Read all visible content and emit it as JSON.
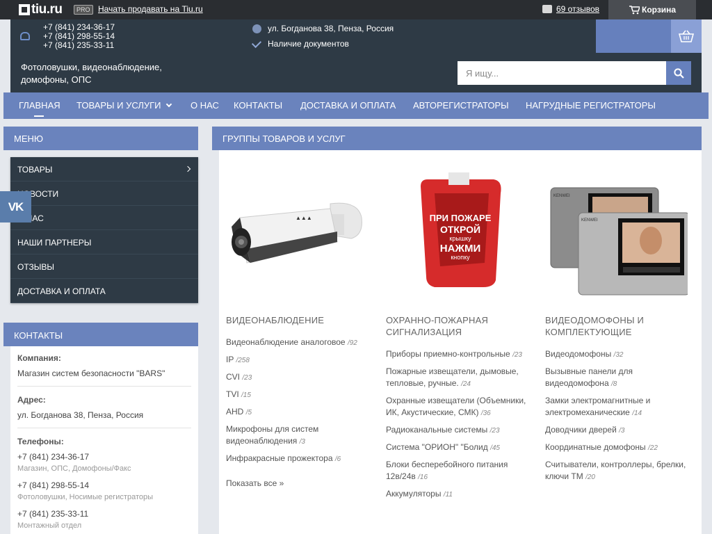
{
  "topbar": {
    "logo_text": "tiu.ru",
    "pro_badge": "PRO",
    "sell_link": "Начать продавать на Tiu.ru",
    "reviews_link": "69 отзывов",
    "cart_label": "Корзина"
  },
  "header": {
    "phones": [
      "+7 (841) 234-36-17",
      "+7 (841) 298-55-14",
      "+7 (841) 235-33-11"
    ],
    "address": "ул. Богданова 38, Пенза, Россия",
    "documents": "Наличие документов",
    "tagline": "Фотоловушки, видеонаблюдение, домофоны, ОПС",
    "search_placeholder": "Я ищу..."
  },
  "nav": {
    "items": [
      "Главная",
      "Товары и услуги",
      "О нас",
      "Контакты",
      "Доставка и оплата",
      "Авторегистраторы",
      "Нагрудные регистраторы"
    ]
  },
  "side_menu": {
    "title": "МЕНЮ",
    "items": [
      "Товары",
      "Новости",
      "О нас",
      "Наши партнеры",
      "Отзывы",
      "Доставка и оплата"
    ]
  },
  "vk_label": "VK",
  "contacts": {
    "title": "КОНТАКТЫ",
    "company_label": "Компания:",
    "company": "Магазин систем безопасности \"BARS\"",
    "address_label": "Адрес:",
    "address": "ул. Богданова 38, Пенза, Россия",
    "phones_label": "Телефоны:",
    "phones": [
      {
        "number": "+7 (841) 234-36-17",
        "note": "Магазин, ОПС, Домофоны/Факс"
      },
      {
        "number": "+7 (841) 298-55-14",
        "note": "Фотоловушки, Носимые регистраторы"
      },
      {
        "number": "+7 (841) 235-33-11",
        "note": "Монтажный отдел"
      }
    ]
  },
  "main": {
    "title": "ГРУППЫ ТОВАРОВ И УСЛУГ",
    "columns": [
      {
        "title": "Видеонаблюдение",
        "items": [
          {
            "name": "Видеонаблюдение аналоговое",
            "count": "/92"
          },
          {
            "name": "IP",
            "count": "/258"
          },
          {
            "name": "CVI",
            "count": "/23"
          },
          {
            "name": "TVI",
            "count": "/15"
          },
          {
            "name": "AHD",
            "count": "/5"
          },
          {
            "name": "Микрофоны для систем видеонаблюдения",
            "count": "/3"
          },
          {
            "name": "Инфракрасные прожектора",
            "count": "/6"
          }
        ],
        "show_all": "Показать все"
      },
      {
        "title": "Охранно-пожарная сигнализация",
        "items": [
          {
            "name": "Приборы приемно-контрольные",
            "count": "/23"
          },
          {
            "name": "Пожарные извещатели, дымовые, тепловые, ручные.",
            "count": "/24"
          },
          {
            "name": "Охранные извещатели (Объемники, ИК, Акустические, СМК)",
            "count": "/36"
          },
          {
            "name": "Радиоканальные системы",
            "count": "/23"
          },
          {
            "name": "Система \"ОРИОН\" \"Болид",
            "count": "/45"
          },
          {
            "name": "Блоки бесперебойного питания 12в/24в",
            "count": "/16"
          },
          {
            "name": "Аккумуляторы",
            "count": "/11"
          }
        ]
      },
      {
        "title": "Видеодомофоны и комплектующие",
        "items": [
          {
            "name": "Видеодомофоны",
            "count": "/32"
          },
          {
            "name": "Вызывные панели для видеодомофона",
            "count": "/8"
          },
          {
            "name": "Замки электромагнитные и электромеханические",
            "count": "/14"
          },
          {
            "name": "Доводчики дверей",
            "count": "/3"
          },
          {
            "name": "Координатные домофоны",
            "count": "/22"
          },
          {
            "name": "Считыватели, контроллеры, брелки, ключи ТМ",
            "count": "/20"
          }
        ]
      }
    ],
    "sign_text": [
      "ПРИ ПОЖАРЕ",
      "ОТКРОЙ",
      "крышку",
      "НАЖМИ",
      "кнопку"
    ]
  }
}
